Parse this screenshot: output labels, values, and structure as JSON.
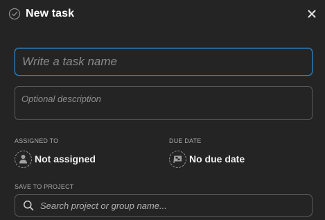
{
  "header": {
    "title": "New task",
    "icon": "check-circle-icon",
    "close_icon": "close-icon"
  },
  "task_name": {
    "placeholder": "Write a task name",
    "value": ""
  },
  "description": {
    "placeholder": "Optional description",
    "value": ""
  },
  "assigned": {
    "label": "ASSIGNED TO",
    "value": "Not assigned",
    "icon": "user-icon"
  },
  "due_date": {
    "label": "DUE DATE",
    "value": "No due date",
    "icon": "calendar-flag-icon"
  },
  "project": {
    "label": "SAVE TO PROJECT",
    "search_placeholder": "Search project or group name...",
    "search_icon": "search-icon"
  },
  "colors": {
    "background": "#242424",
    "focus_border": "#2f86c9",
    "field_border": "#5a5a5a",
    "label_text": "#a8a8a8"
  }
}
